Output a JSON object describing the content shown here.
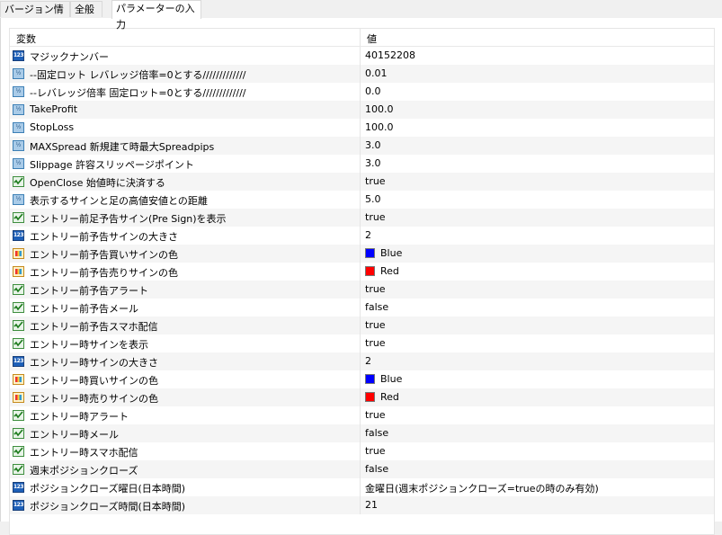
{
  "tabs": [
    "バージョン情報",
    "全般",
    "パラメーターの入力"
  ],
  "columns": {
    "name": "変数",
    "value": "値"
  },
  "rows": [
    {
      "name": "マジックナンバー",
      "value": "40152208",
      "icon": "int"
    },
    {
      "name": "--固定ロット レバレッジ倍率=0とする/////////////",
      "value": "0.01",
      "icon": "dbl"
    },
    {
      "name": "--レバレッジ倍率 固定ロット=0とする/////////////",
      "value": "0.0",
      "icon": "dbl"
    },
    {
      "name": "TakeProfit",
      "value": "100.0",
      "icon": "dbl"
    },
    {
      "name": "StopLoss",
      "value": "100.0",
      "icon": "dbl"
    },
    {
      "name": "MAXSpread 新規建て時最大Spreadpips",
      "value": "3.0",
      "icon": "dbl"
    },
    {
      "name": "Slippage 許容スリッページポイント",
      "value": "3.0",
      "icon": "dbl"
    },
    {
      "name": "OpenClose 始値時に決済する",
      "value": "true",
      "icon": "bool"
    },
    {
      "name": "表示するサインと足の高値安値との距離",
      "value": "5.0",
      "icon": "dbl"
    },
    {
      "name": "エントリー前足予告サイン(Pre Sign)を表示",
      "value": "true",
      "icon": "bool"
    },
    {
      "name": "エントリー前予告サインの大きさ",
      "value": "2",
      "icon": "int"
    },
    {
      "name": "エントリー前予告買いサインの色",
      "value": "Blue",
      "icon": "color",
      "swatch": "#0000ff"
    },
    {
      "name": "エントリー前予告売りサインの色",
      "value": "Red",
      "icon": "color",
      "swatch": "#ff0000"
    },
    {
      "name": "エントリー前予告アラート",
      "value": "true",
      "icon": "bool"
    },
    {
      "name": "エントリー前予告メール",
      "value": "false",
      "icon": "bool"
    },
    {
      "name": "エントリー前予告スマホ配信",
      "value": "true",
      "icon": "bool"
    },
    {
      "name": "エントリー時サインを表示",
      "value": "true",
      "icon": "bool"
    },
    {
      "name": "エントリー時サインの大きさ",
      "value": "2",
      "icon": "int"
    },
    {
      "name": "エントリー時買いサインの色",
      "value": "Blue",
      "icon": "color",
      "swatch": "#0000ff"
    },
    {
      "name": "エントリー時売りサインの色",
      "value": "Red",
      "icon": "color",
      "swatch": "#ff0000"
    },
    {
      "name": "エントリー時アラート",
      "value": "true",
      "icon": "bool"
    },
    {
      "name": "エントリー時メール",
      "value": "false",
      "icon": "bool"
    },
    {
      "name": "エントリー時スマホ配信",
      "value": "true",
      "icon": "bool"
    },
    {
      "name": "週末ポジションクローズ",
      "value": "false",
      "icon": "bool"
    },
    {
      "name": "ポジションクローズ曜日(日本時間)",
      "value": "金曜日(週末ポジションクローズ=trueの時のみ有効)",
      "icon": "int"
    },
    {
      "name": "ポジションクローズ時間(日本時間)",
      "value": "21",
      "icon": "int"
    }
  ]
}
